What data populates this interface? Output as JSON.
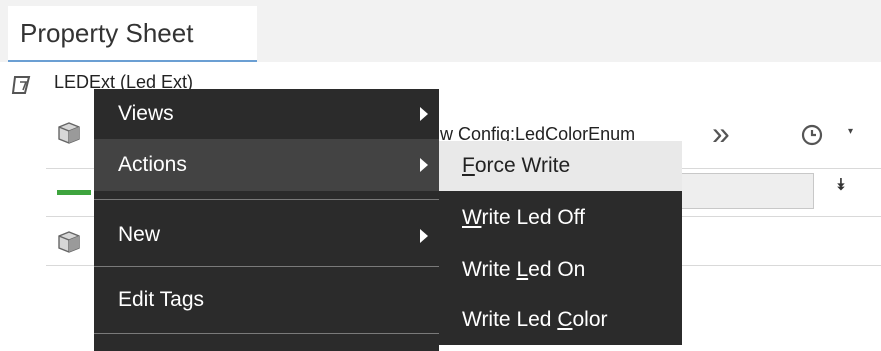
{
  "tab": {
    "label": "Property Sheet"
  },
  "tree": {
    "root_label": "LEDExt  (Led Ext)",
    "rows": [
      {
        "value_fragment": "w  Config:LedColorEnum"
      },
      {},
      {}
    ]
  },
  "toolbar": {
    "chevrons": "»",
    "dropdown_caret": "▾",
    "collapse_glyph": "⯯"
  },
  "context_menu": {
    "items": [
      {
        "label": "Views",
        "has_submenu": true
      },
      {
        "label": "Actions",
        "has_submenu": true,
        "highlighted": true
      },
      {
        "label": "New",
        "has_submenu": true
      },
      {
        "label": "Edit Tags",
        "has_submenu": false
      }
    ]
  },
  "submenu": {
    "items": [
      {
        "pre": "",
        "mn": "F",
        "post": "orce Write",
        "highlighted": true
      },
      {
        "pre": "",
        "mn": "W",
        "post": "rite Led Off"
      },
      {
        "pre": "Write ",
        "mn": "L",
        "post": "ed On"
      },
      {
        "pre": "Write Led ",
        "mn": "C",
        "post": "olor"
      }
    ]
  },
  "colors": {
    "menu_bg": "#2b2b2b",
    "menu_highlight": "#434343",
    "submenu_highlight": "#e9e9e9",
    "status_green": "#3ea43e",
    "tab_underline": "#6b9fd3"
  }
}
